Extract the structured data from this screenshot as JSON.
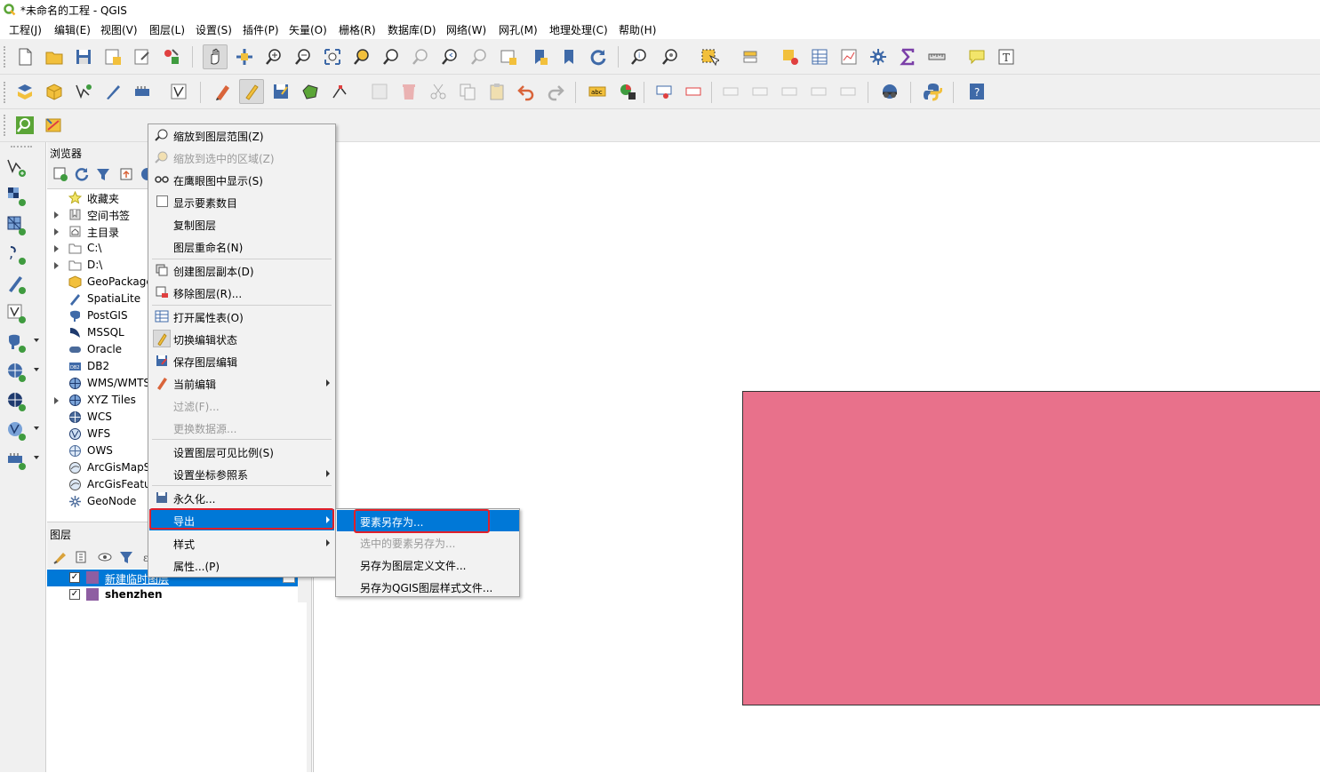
{
  "window": {
    "title": "*未命名的工程 - QGIS"
  },
  "menubar": {
    "items": [
      "工程(J)",
      "编辑(E)",
      "视图(V)",
      "图层(L)",
      "设置(S)",
      "插件(P)",
      "矢量(O)",
      "栅格(R)",
      "数据库(D)",
      "网络(W)",
      "网孔(M)",
      "地理处理(C)",
      "帮助(H)"
    ]
  },
  "colors": {
    "accent": "#0078d7",
    "feature_fill": "#e8718b",
    "highlight_box": "#e0202a",
    "layer_swatch": "#8e5ea2"
  },
  "browser": {
    "title": "浏览器",
    "items": [
      {
        "label": "收藏夹",
        "icon": "star-icon",
        "expandable": false
      },
      {
        "label": "空间书签",
        "icon": "bookmark-icon",
        "expandable": true
      },
      {
        "label": "主目录",
        "icon": "home-folder-icon",
        "expandable": true
      },
      {
        "label": "C:\\",
        "icon": "folder-icon",
        "expandable": true
      },
      {
        "label": "D:\\",
        "icon": "folder-icon",
        "expandable": true
      },
      {
        "label": "GeoPackage",
        "icon": "geopackage-icon",
        "expandable": false
      },
      {
        "label": "SpatiaLite",
        "icon": "spatialite-icon",
        "expandable": false
      },
      {
        "label": "PostGIS",
        "icon": "postgis-icon",
        "expandable": false
      },
      {
        "label": "MSSQL",
        "icon": "mssql-icon",
        "expandable": false
      },
      {
        "label": "Oracle",
        "icon": "oracle-icon",
        "expandable": false
      },
      {
        "label": "DB2",
        "icon": "db2-icon",
        "expandable": false
      },
      {
        "label": "WMS/WMTS",
        "icon": "wms-icon",
        "expandable": false
      },
      {
        "label": "XYZ Tiles",
        "icon": "xyz-icon",
        "expandable": true
      },
      {
        "label": "WCS",
        "icon": "wcs-icon",
        "expandable": false
      },
      {
        "label": "WFS",
        "icon": "wfs-icon",
        "expandable": false
      },
      {
        "label": "OWS",
        "icon": "ows-icon",
        "expandable": false
      },
      {
        "label": "ArcGisMapServer",
        "icon": "arcgis-map-icon",
        "expandable": false
      },
      {
        "label": "ArcGisFeatureServer",
        "icon": "arcgis-feature-icon",
        "expandable": false
      },
      {
        "label": "GeoNode",
        "icon": "geonode-icon",
        "expandable": false
      }
    ]
  },
  "layers": {
    "title": "图层",
    "items": [
      {
        "label": "新建临时图层",
        "checked": true,
        "selected": true
      },
      {
        "label": "shenzhen",
        "checked": true,
        "selected": false
      }
    ]
  },
  "context_menu": {
    "items": [
      {
        "label": "缩放到图层范围(Z)",
        "icon": "zoom-layer-icon"
      },
      {
        "label": "缩放到选中的区域(Z)",
        "icon": "zoom-selection-icon",
        "disabled": true
      },
      {
        "label": "在鹰眼图中显示(S)",
        "icon": "overview-icon"
      },
      {
        "label": "显示要素数目",
        "icon": "checkbox-icon"
      },
      {
        "label": "复制图层"
      },
      {
        "label": "图层重命名(N)"
      },
      {
        "label": "创建图层副本(D)",
        "icon": "duplicate-layer-icon"
      },
      {
        "label": "移除图层(R)...",
        "icon": "remove-layer-icon"
      },
      {
        "label": "打开属性表(O)",
        "icon": "attribute-table-icon"
      },
      {
        "label": "切换编辑状态",
        "icon": "toggle-edit-icon"
      },
      {
        "label": "保存图层编辑",
        "icon": "save-edits-icon"
      },
      {
        "label": "当前编辑",
        "icon": "current-edits-icon",
        "submenu": true
      },
      {
        "label": "过滤(F)...",
        "disabled": true
      },
      {
        "label": "更换数据源...",
        "disabled": true
      },
      {
        "label": "设置图层可见比例(S)"
      },
      {
        "label": "设置坐标参照系",
        "submenu": true
      },
      {
        "label": "永久化...",
        "icon": "make-permanent-icon"
      },
      {
        "label": "导出",
        "submenu": true,
        "highlight": true
      },
      {
        "label": "样式",
        "submenu": true
      },
      {
        "label": "属性...(P)"
      }
    ]
  },
  "export_submenu": {
    "items": [
      {
        "label": "要素另存为...",
        "highlight": true
      },
      {
        "label": "选中的要素另存为...",
        "disabled": true
      },
      {
        "label": "另存为图层定义文件..."
      },
      {
        "label": "另存为QGIS图层样式文件..."
      }
    ]
  }
}
